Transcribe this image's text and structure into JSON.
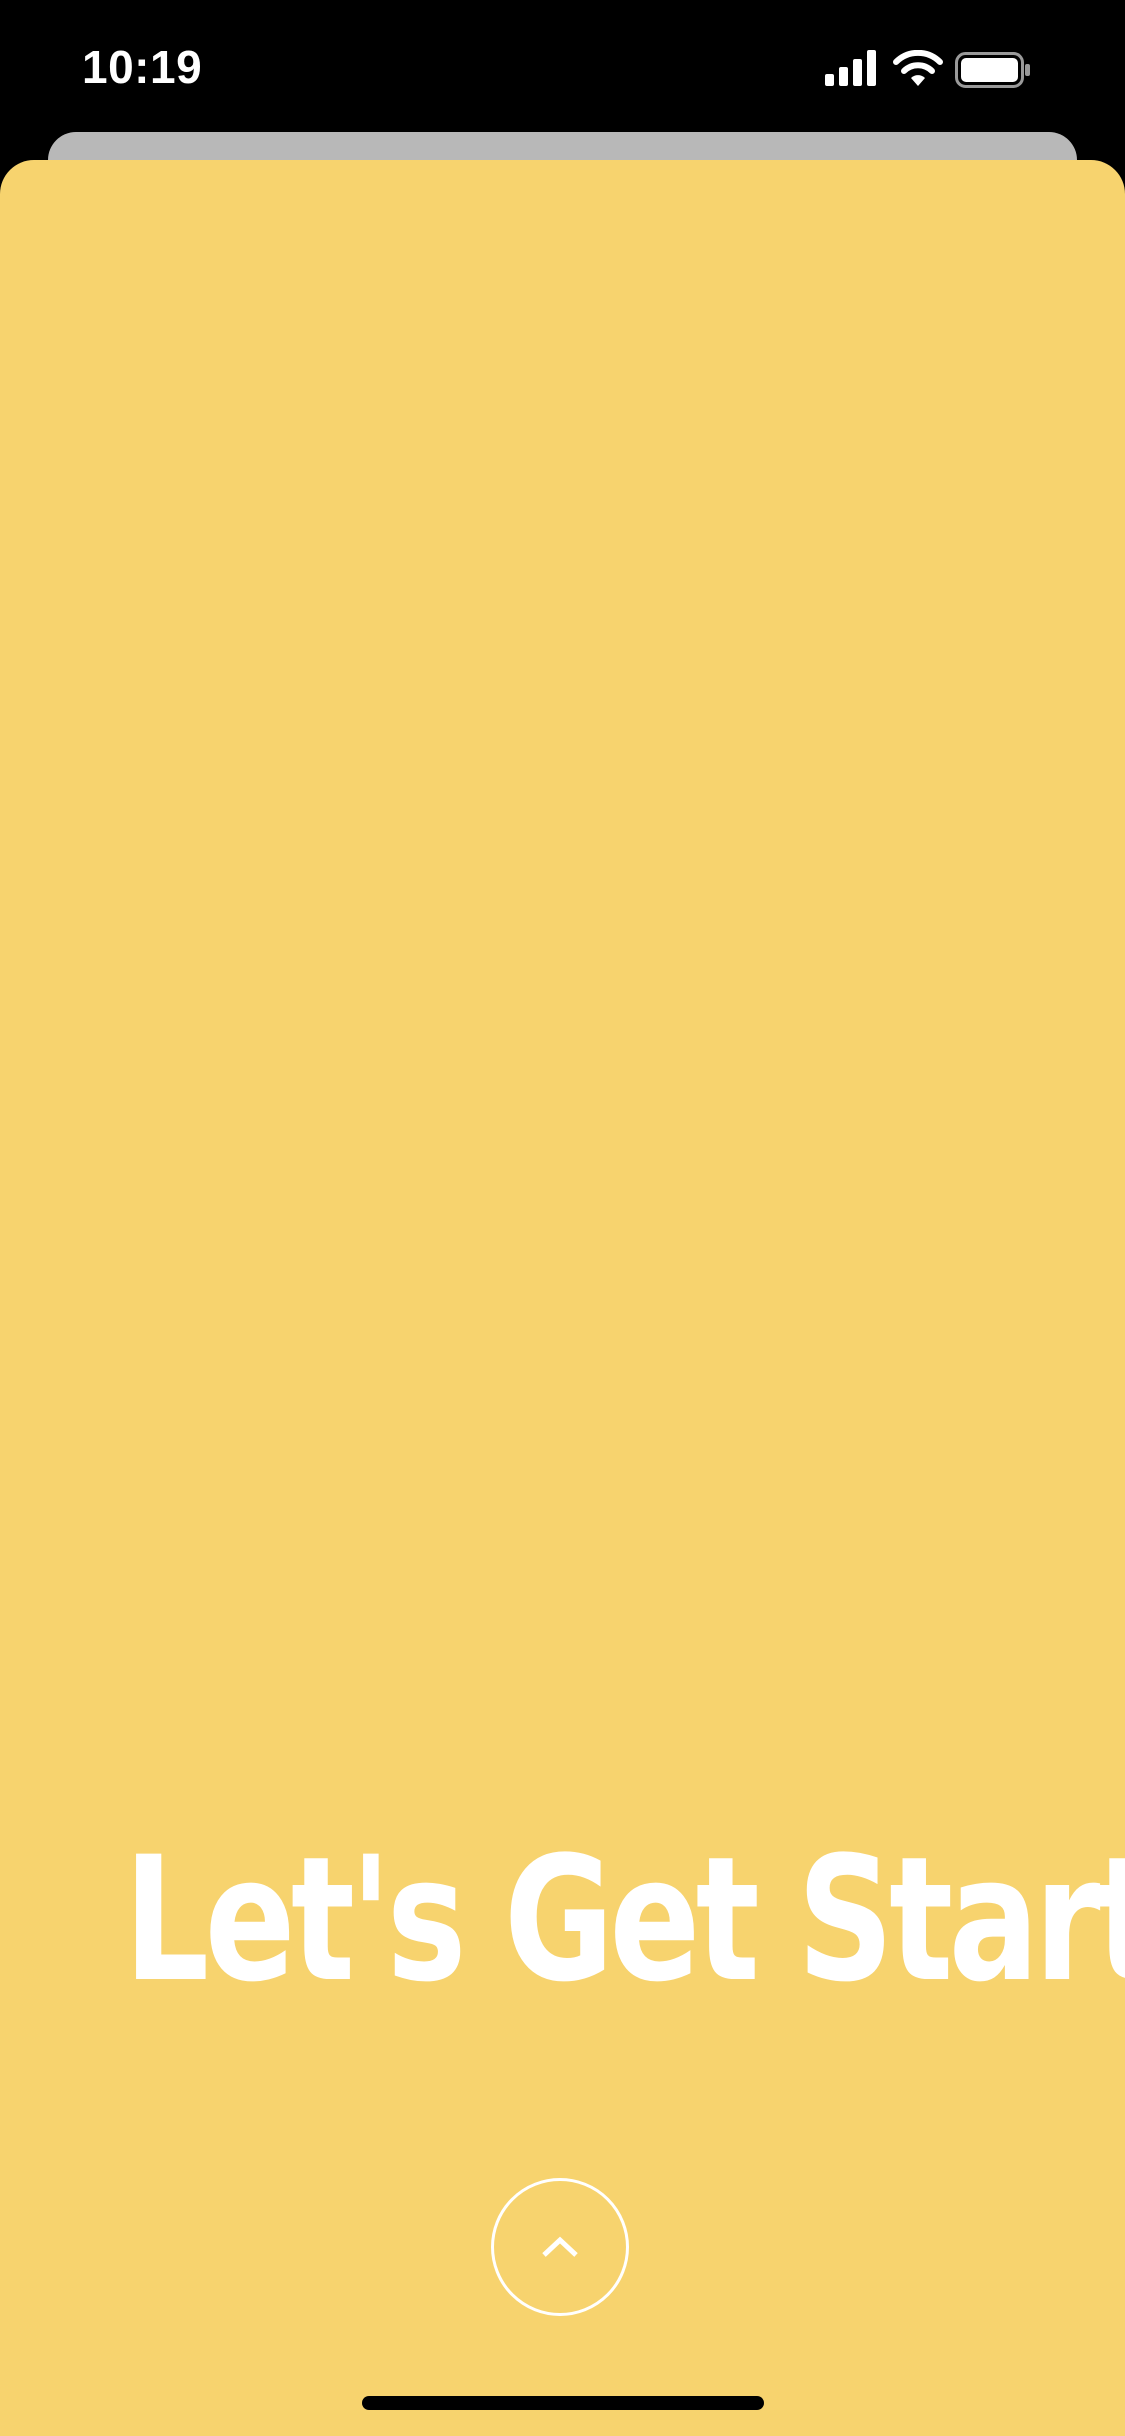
{
  "status_bar": {
    "time": "10:19",
    "icons": [
      "signal-icon",
      "wifi-icon",
      "battery-icon"
    ]
  },
  "main": {
    "headline": "Let's Get Started",
    "action_icon": "chevron-up-icon"
  },
  "colors": {
    "sheet_background": "#f7d36e",
    "text": "#ffffff",
    "status_background": "#000000",
    "back_card": "#b8b8b8"
  }
}
